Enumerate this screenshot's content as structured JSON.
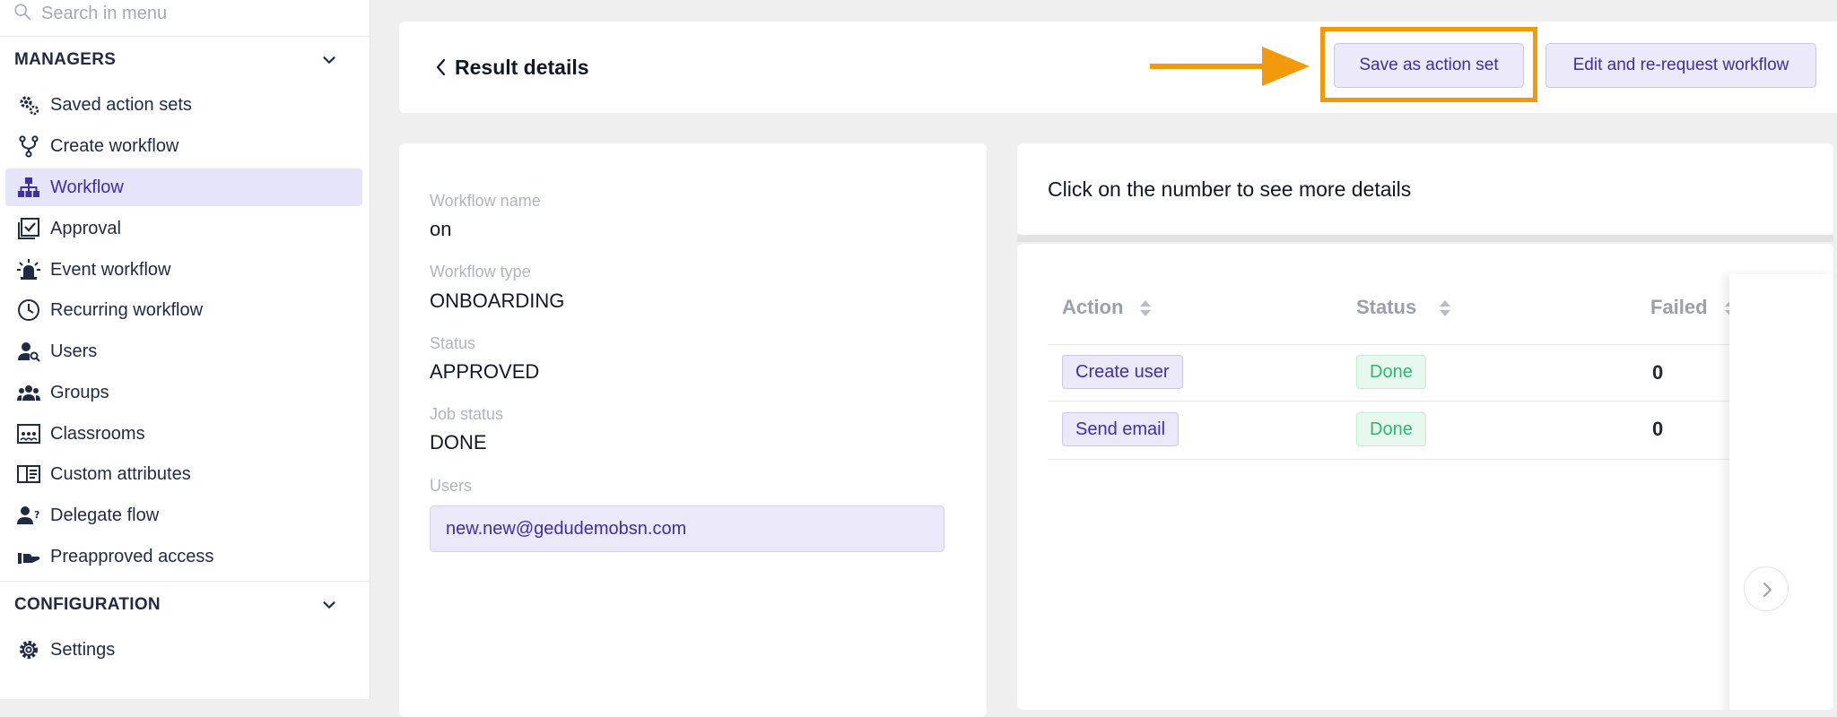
{
  "sidebar": {
    "search": {
      "placeholder": "Search in menu"
    },
    "sections": [
      {
        "title": "MANAGERS",
        "items": [
          {
            "label": "Saved action sets",
            "icon": "gears-icon"
          },
          {
            "label": "Create workflow",
            "icon": "fork-icon"
          },
          {
            "label": "Workflow",
            "icon": "hierarchy-icon",
            "active": true
          },
          {
            "label": "Approval",
            "icon": "approval-icon"
          },
          {
            "label": "Event workflow",
            "icon": "alarm-icon"
          },
          {
            "label": "Recurring workflow",
            "icon": "clock-icon"
          },
          {
            "label": "Users",
            "icon": "user-search-icon"
          },
          {
            "label": "Groups",
            "icon": "group-icon"
          },
          {
            "label": "Classrooms",
            "icon": "classroom-icon"
          },
          {
            "label": "Custom attributes",
            "icon": "attributes-icon"
          },
          {
            "label": "Delegate flow",
            "icon": "delegate-icon"
          },
          {
            "label": "Preapproved access",
            "icon": "hand-icon"
          }
        ]
      },
      {
        "title": "CONFIGURATION",
        "items": [
          {
            "label": "Settings",
            "icon": "gear-icon"
          }
        ]
      }
    ]
  },
  "header": {
    "title": "Result details",
    "save_label": "Save as action set",
    "edit_label": "Edit and re-request workflow"
  },
  "details": {
    "workflow_name_label": "Workflow name",
    "workflow_name": "on",
    "workflow_type_label": "Workflow type",
    "workflow_type": "ONBOARDING",
    "status_label": "Status",
    "status": "APPROVED",
    "job_status_label": "Job status",
    "job_status": "DONE",
    "users_label": "Users",
    "users": [
      "new.new@gedudemobsn.com"
    ]
  },
  "hint": "Click on the number to see more details",
  "table": {
    "columns": [
      "Action",
      "Status",
      "Failed"
    ],
    "rows": [
      {
        "action": "Create user",
        "status": "Done",
        "failed": "0"
      },
      {
        "action": "Send email",
        "status": "Done",
        "failed": "0"
      }
    ]
  },
  "colors": {
    "accent": "#3d2fa8",
    "active_bg": "#e6e4fb",
    "done": "#2cb673",
    "highlight": "#f29a0c"
  }
}
